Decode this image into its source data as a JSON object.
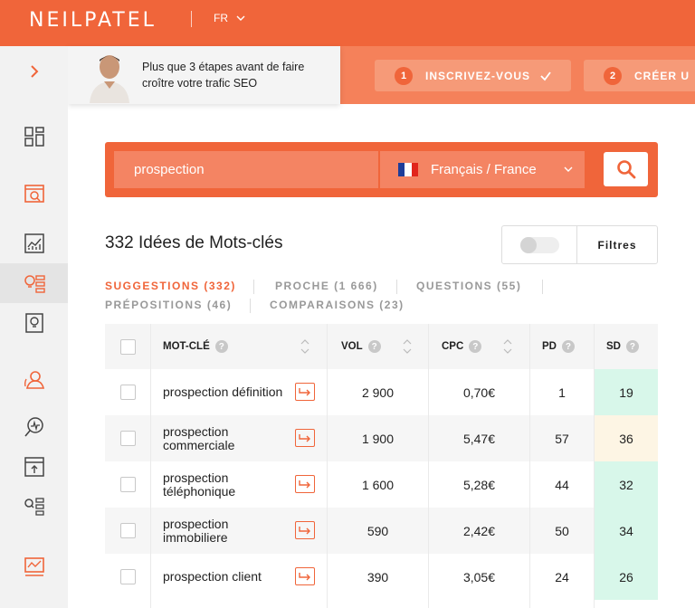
{
  "header": {
    "logo": "NEILPATEL",
    "language": "FR"
  },
  "promo": {
    "text": "Plus que 3 étapes avant de faire croître votre trafic SEO",
    "steps": [
      {
        "num": "1",
        "label": "INSCRIVEZ-VOUS"
      },
      {
        "num": "2",
        "label": "CRÉER U"
      }
    ]
  },
  "sidebar": {
    "items": [
      "expand-arrow",
      "dashboard",
      "site-audit",
      "traffic-analyzer",
      "keyword-ideas",
      "content-ideas",
      "backlinks",
      "rank-tracker",
      "top-pages",
      "keyword-list",
      "traffic-overview"
    ]
  },
  "search": {
    "query": "prospection",
    "locale": "Français / France",
    "flag_colors": [
      "#1f3d99",
      "#ffffff",
      "#e1261c"
    ]
  },
  "results": {
    "title": "332 Idées de Mots-clés",
    "filter_label": "Filtres"
  },
  "tabs": [
    {
      "label": "SUGGESTIONS (332)",
      "active": true
    },
    {
      "label": "PROCHE (1 666)",
      "active": false
    },
    {
      "label": "QUESTIONS (55)",
      "active": false
    },
    {
      "label": "PRÉPOSITIONS (46)",
      "active": false
    },
    {
      "label": "COMPARAISONS (23)",
      "active": false
    }
  ],
  "table": {
    "headers": {
      "keyword": "MOT-CLÉ",
      "vol": "VOL",
      "cpc": "CPC",
      "pd": "PD",
      "sd": "SD",
      "info": "?"
    },
    "rows": [
      {
        "keyword": [
          "prospection définition"
        ],
        "vol": "2 900",
        "cpc": "0,70€",
        "pd": "1",
        "sd": "19",
        "sd_color": "#d8f7ea"
      },
      {
        "keyword": [
          "prospection",
          "commerciale"
        ],
        "vol": "1 900",
        "cpc": "5,47€",
        "pd": "57",
        "sd": "36",
        "sd_color": "#fdf5e4"
      },
      {
        "keyword": [
          "prospection",
          "téléphonique"
        ],
        "vol": "1 600",
        "cpc": "5,28€",
        "pd": "44",
        "sd": "32",
        "sd_color": "#d8f7ea"
      },
      {
        "keyword": [
          "prospection",
          "immobiliere"
        ],
        "vol": "590",
        "cpc": "2,42€",
        "pd": "50",
        "sd": "34",
        "sd_color": "#d8f7ea"
      },
      {
        "keyword": [
          "prospection client"
        ],
        "vol": "390",
        "cpc": "3,05€",
        "pd": "24",
        "sd": "26",
        "sd_color": "#d8f7ea"
      }
    ]
  },
  "colors": {
    "brand": "#f0653a",
    "brand_light": "#f48463"
  }
}
